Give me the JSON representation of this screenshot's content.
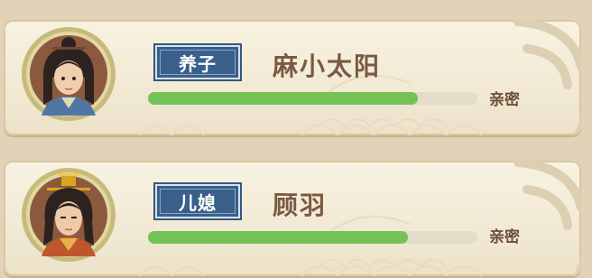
{
  "members": [
    {
      "relation": "养子",
      "name": "麻小太阳",
      "intimacy_label": "亲密",
      "intimacy_fraction": 0.82
    },
    {
      "relation": "儿媳",
      "name": "顾羽",
      "intimacy_label": "亲密",
      "intimacy_fraction": 0.79
    }
  ],
  "colors": {
    "badge_bg": "#3a5f8a",
    "bar_fill": "#73c255",
    "bar_track": "#e3dcc9",
    "name_text": "#7a5a42",
    "card_bg": "#f5eedd"
  },
  "icons": [
    "adopted-son-avatar-icon",
    "daughter-in-law-avatar-icon"
  ]
}
